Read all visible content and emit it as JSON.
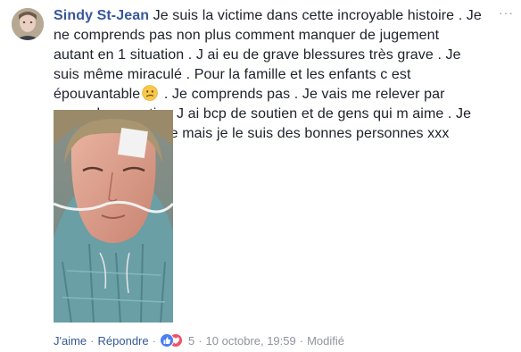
{
  "comment": {
    "author": "Sindy St-Jean",
    "text_before_emoji": " Je suis la victime dans cette incroyable histoire . Je ne comprends pas non plus comment manquer de jugement autant en 1 situation . J ai eu de grave blessures très grave . Je suis même miraculé . Pour la famille et les enfants c est épouvantable",
    "emoji": "confused-face-emoji",
    "text_after_emoji": " . Je comprends pas . Je vais me relever par exemple garantie . J ai bcp de soutien et de gens qui m aime . Je ne suis pas connue mais je le suis des bonnes personnes xxx",
    "options_label": "···"
  },
  "actions": {
    "like_label": "J'aime",
    "separator": "·",
    "reply_label": "Répondre",
    "reaction_count": "5",
    "timestamp": "10 octobre, 19:59",
    "edited_label": "Modifié"
  },
  "colors": {
    "author": "#365899",
    "text": "#1d2129",
    "meta": "#90949c",
    "like_reaction": "#4c7ff0",
    "love_reaction": "#f25268"
  },
  "icons": {
    "options": "more-options-icon",
    "like": "like-reaction-icon",
    "love": "love-reaction-icon"
  }
}
